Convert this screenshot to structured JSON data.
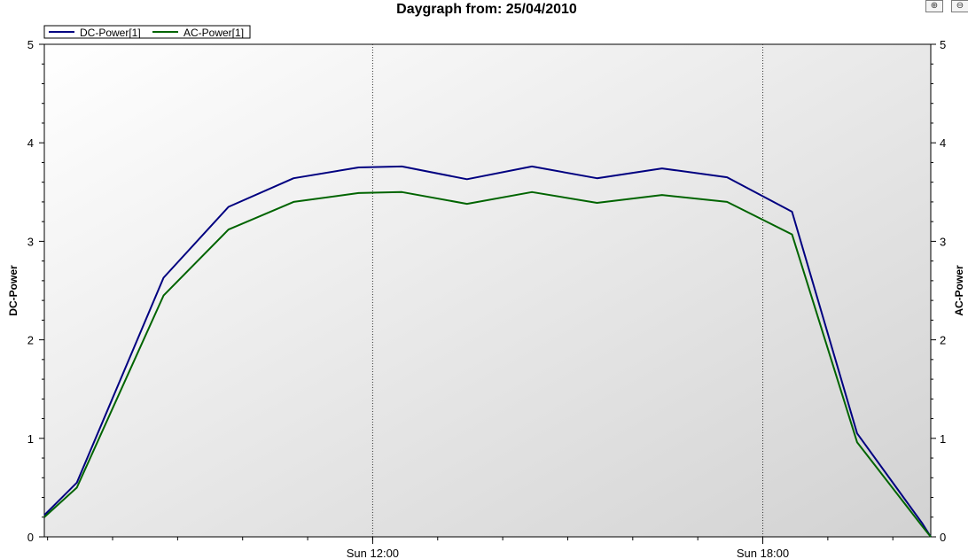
{
  "chart_data": {
    "type": "line",
    "title": "Daygraph from: 25/04/2010",
    "ylabel": "DC-Power",
    "y2label": "AC-Power",
    "ylim": [
      0,
      5
    ],
    "y2lim": [
      0,
      5
    ],
    "yticks": [
      "0",
      "1",
      "2",
      "3",
      "4",
      "5"
    ],
    "xlim": [
      "06:57",
      "20:35"
    ],
    "xticks": [
      {
        "label": "Sun 12:00",
        "value": "12:00"
      },
      {
        "label": "Sun 18:00",
        "value": "18:00"
      }
    ],
    "grid": "vertical dotted at labelled x ticks",
    "legend": "top-left",
    "series": [
      {
        "name": "DC-Power[1]",
        "color": "#000080",
        "x": [
          "06:57",
          "07:27",
          "08:47",
          "09:47",
          "10:47",
          "11:47",
          "12:27",
          "13:27",
          "14:27",
          "15:27",
          "16:27",
          "17:27",
          "18:27",
          "19:27",
          "20:27",
          "20:35"
        ],
        "values": [
          0.22,
          0.55,
          2.63,
          3.35,
          3.64,
          3.75,
          3.76,
          3.63,
          3.76,
          3.64,
          3.74,
          3.65,
          3.3,
          1.05,
          0.14,
          0.0
        ]
      },
      {
        "name": "AC-Power[1]",
        "color": "#006400",
        "x": [
          "06:57",
          "07:27",
          "08:47",
          "09:47",
          "10:47",
          "11:47",
          "12:27",
          "13:27",
          "14:27",
          "15:27",
          "16:27",
          "17:27",
          "18:27",
          "19:27",
          "20:27",
          "20:35"
        ],
        "values": [
          0.2,
          0.5,
          2.45,
          3.12,
          3.4,
          3.49,
          3.5,
          3.38,
          3.5,
          3.39,
          3.47,
          3.4,
          3.07,
          0.96,
          0.11,
          0.0
        ]
      }
    ]
  },
  "toolbar": {
    "zoom_in_icon": "magnifier-plus-icon",
    "zoom_out_icon": "magnifier-minus-icon",
    "zoom_in_glyph": "⊕",
    "zoom_out_glyph": "⊖"
  }
}
